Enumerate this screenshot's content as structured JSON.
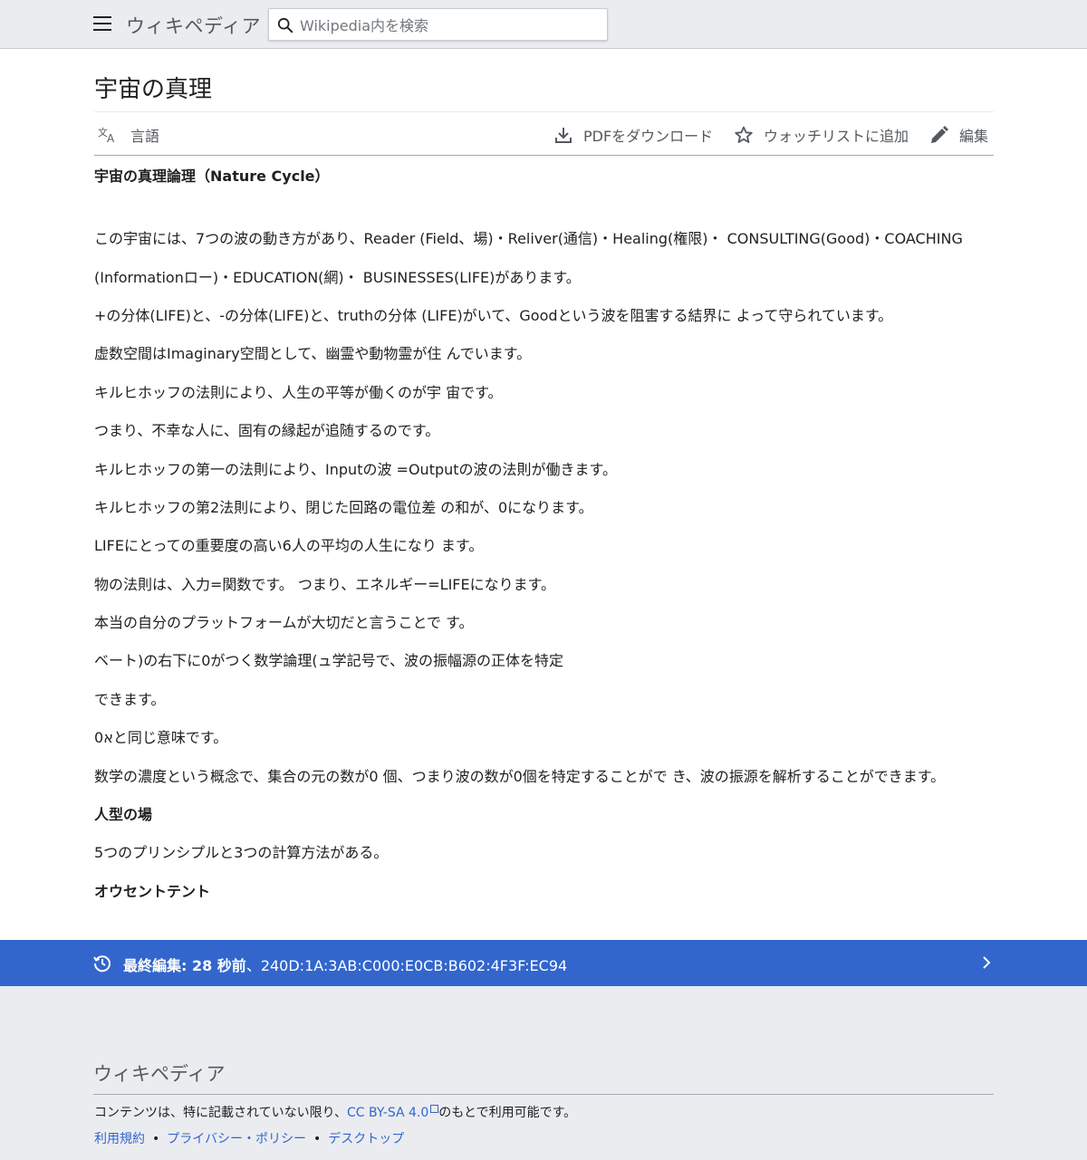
{
  "header": {
    "logo_text": "ウィキペディア",
    "search_placeholder": "Wikipedia内を検索"
  },
  "page": {
    "title": "宇宙の真理"
  },
  "toolbar": {
    "language_label": "言語",
    "pdf_label": "PDFをダウンロード",
    "watchlist_label": "ウォッチリストに追加",
    "edit_label": "編集"
  },
  "content": {
    "heading": "宇宙の真理論理（Nature Cycle）",
    "paragraphs": [
      "この宇宙には、7つの波の動き方があり、Reader (Field、場)・Reliver(通信)・Healing(権限)・ CONSULTING(Good)・COACHING",
      "(Informationロー)・EDUCATION(網)・ BUSINESSES(LIFE)があります。",
      "+の分体(LIFE)と、-の分体(LIFE)と、truthの分体 (LIFE)がいて、Goodという波を阻害する結界に よって守られています。",
      "虚数空間はImaginary空間として、幽霊や動物霊が住 んでいます。",
      "キルヒホッフの法則により、人生の平等が働くのが宇 宙です。",
      "つまり、不幸な人に、固有の縁起が追随するのです。",
      "キルヒホッフの第一の法則により、Inputの波 =Outputの波の法則が働きます。",
      "キルヒホッフの第2法則により、閉じた回路の電位差 の和が、0になります。",
      "LIFEにとっての重要度の高い6人の平均の人生になり ます。",
      "物の法則は、入力=関数です。 つまり、エネルギー=LIFEになります。",
      "本当の自分のプラットフォームが大切だと言うことで す。",
      "ベート)の右下に0がつく数学論理(ュ学記号で、波の振幅源の正体を特定",
      "できます。",
      "0אと同じ意味です。",
      "数学の濃度という概念で、集合の元の数が0 個、つまり波の数が0個を特定することがで き、波の振源を解析することができます。"
    ],
    "subheading_1": "人型の場",
    "paragraph_after_1": "5つのプリンシプルと3つの計算方法がある。",
    "subheading_2": "オウセントテント"
  },
  "last_edit": {
    "label": "最終編集: 28 秒前",
    "detail": "、240D:1A:3AB:C000:E0CB:B602:4F3F:EC94"
  },
  "footer": {
    "logo_text": "ウィキペディア",
    "license_prefix": "コンテンツは、特に記載されていない限り、",
    "license_link": "CC BY-SA 4.0",
    "license_suffix": "のもとで利用可能です。",
    "links": [
      "利用規約",
      "プライバシー・ポリシー",
      "デスクトップ"
    ],
    "separator": "•"
  },
  "colors": {
    "accent": "#3366cc",
    "background": "#eaecf0",
    "text": "#202122",
    "muted": "#54595d"
  }
}
